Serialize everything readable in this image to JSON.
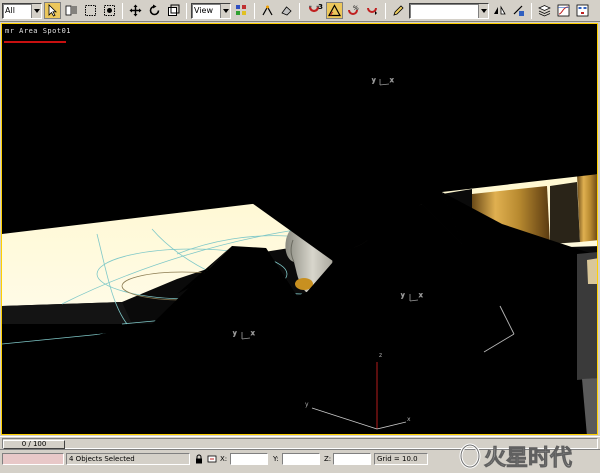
{
  "toolbar": {
    "selection_filter": "All",
    "reference_coord": "View",
    "named_selection": "",
    "snap_count": "3",
    "icons": [
      "select-arrow-icon",
      "select-by-name-icon",
      "rect-region-icon",
      "window-crossing-icon",
      "move-icon",
      "rotate-icon",
      "scale-icon",
      "pivot-center-icon",
      "manipulate-icon",
      "keyboard-shortcut-icon",
      "snap-3d-icon",
      "angle-snap-icon",
      "percent-snap-icon",
      "spinner-snap-icon",
      "edit-named-sel-icon",
      "mirror-icon",
      "align-icon",
      "layer-manager-icon",
      "curve-editor-icon",
      "schematic-view-icon"
    ]
  },
  "viewport": {
    "label": "mr Area Spot01",
    "axis_labels": {
      "x": "x",
      "y": "y",
      "z": "z"
    }
  },
  "timeslider": {
    "label": "0 / 100",
    "frame": 0,
    "total": 100
  },
  "statusbar": {
    "selection_info": "4 Objects Selected",
    "x_label": "X:",
    "y_label": "Y:",
    "z_label": "Z:",
    "x_value": "",
    "y_value": "",
    "z_value": "",
    "grid": "Grid = 10.0"
  },
  "watermark": {
    "text": "火星时代"
  },
  "colors": {
    "viewport_active_border": "#ffd000",
    "active_tool": "#ecc75b",
    "label_underline": "#c81010",
    "scene_floor": "#fff5c8",
    "scene_wall": "#c89a3a",
    "wireframe": "#7fc8c8"
  }
}
